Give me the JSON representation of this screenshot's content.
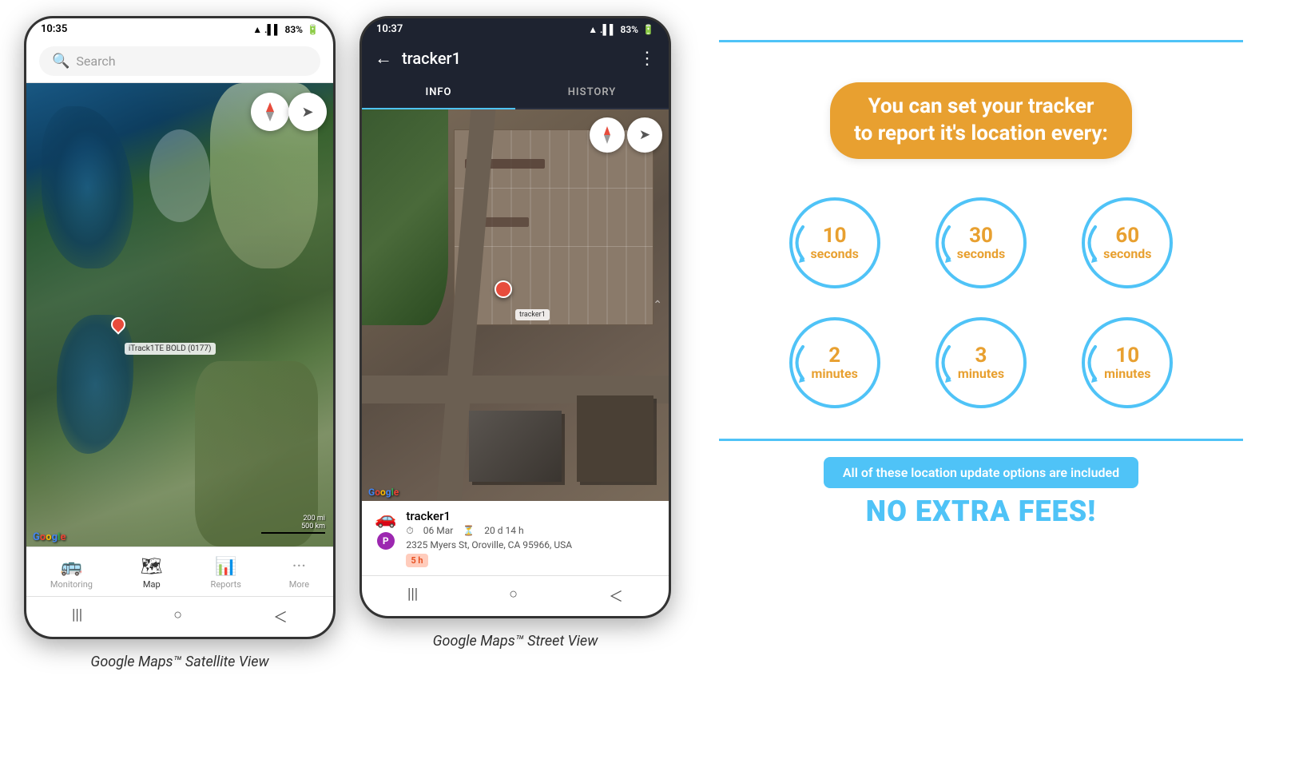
{
  "phone1": {
    "status": {
      "time": "10:35",
      "signal": "▲.▌▌",
      "battery": "83%"
    },
    "search": {
      "placeholder": "Search"
    },
    "map": {
      "tracker_label": "iTrack1TE BOLD (0177)",
      "scale_mi": "200 mi",
      "scale_km": "500 km"
    },
    "nav": {
      "items": [
        {
          "icon": "🚌",
          "label": "Monitoring",
          "active": false
        },
        {
          "icon": "🗺",
          "label": "Map",
          "active": true
        },
        {
          "icon": "📊",
          "label": "Reports",
          "active": false
        },
        {
          "icon": "···",
          "label": "More",
          "active": false
        }
      ]
    },
    "caption": "Google Maps™ Satellite View"
  },
  "phone2": {
    "status": {
      "time": "10:37",
      "signal": "▲.▌▌",
      "battery": "83%"
    },
    "header": {
      "back": "←",
      "title": "tracker1",
      "more": "⋮"
    },
    "tabs": [
      {
        "label": "INFO",
        "active": true
      },
      {
        "label": "HISTORY",
        "active": false
      }
    ],
    "tracker_info": {
      "name": "tracker1",
      "date": "06 Mar",
      "duration": "20 d 14 h",
      "address": "2325 Myers St, Oroville, CA 95966, USA",
      "since": "5 h",
      "pin_label": "tracker1"
    },
    "caption": "Google Maps™ Street View"
  },
  "infographic": {
    "headline": "You can set your tracker\nto report it's location every:",
    "intervals": [
      {
        "num": "10",
        "unit": "seconds"
      },
      {
        "num": "30",
        "unit": "seconds"
      },
      {
        "num": "60",
        "unit": "seconds"
      },
      {
        "num": "2",
        "unit": "minutes"
      },
      {
        "num": "3",
        "unit": "minutes"
      },
      {
        "num": "10",
        "unit": "minutes"
      }
    ],
    "included_text": "All of these location update options are included",
    "no_fees": "NO EXTRA FEES!"
  }
}
